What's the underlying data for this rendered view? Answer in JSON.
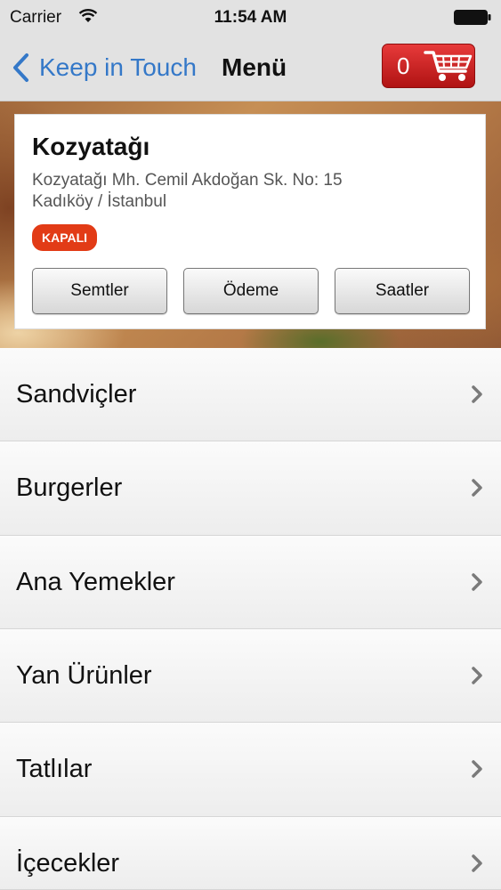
{
  "status_bar": {
    "carrier": "Carrier",
    "time": "11:54 AM"
  },
  "nav": {
    "back_label": "Keep in Touch",
    "title": "Menü",
    "cart_count": "0"
  },
  "store": {
    "name": "Kozyatağı",
    "address_line1": "Kozyatağı Mh. Cemil Akdoğan Sk. No: 15",
    "address_line2": "Kadıköy / İstanbul",
    "status": "KAPALI",
    "buttons": [
      "Semtler",
      "Ödeme",
      "Saatler"
    ]
  },
  "menu": {
    "items": [
      {
        "label": "Sandviçler"
      },
      {
        "label": "Burgerler"
      },
      {
        "label": "Ana Yemekler"
      },
      {
        "label": "Yan Ürünler"
      },
      {
        "label": "Tatlılar"
      },
      {
        "label": "İçecekler"
      }
    ]
  },
  "colors": {
    "accent_blue": "#3478c8",
    "cart_red": "#d42525",
    "badge_red": "#e23b16"
  }
}
